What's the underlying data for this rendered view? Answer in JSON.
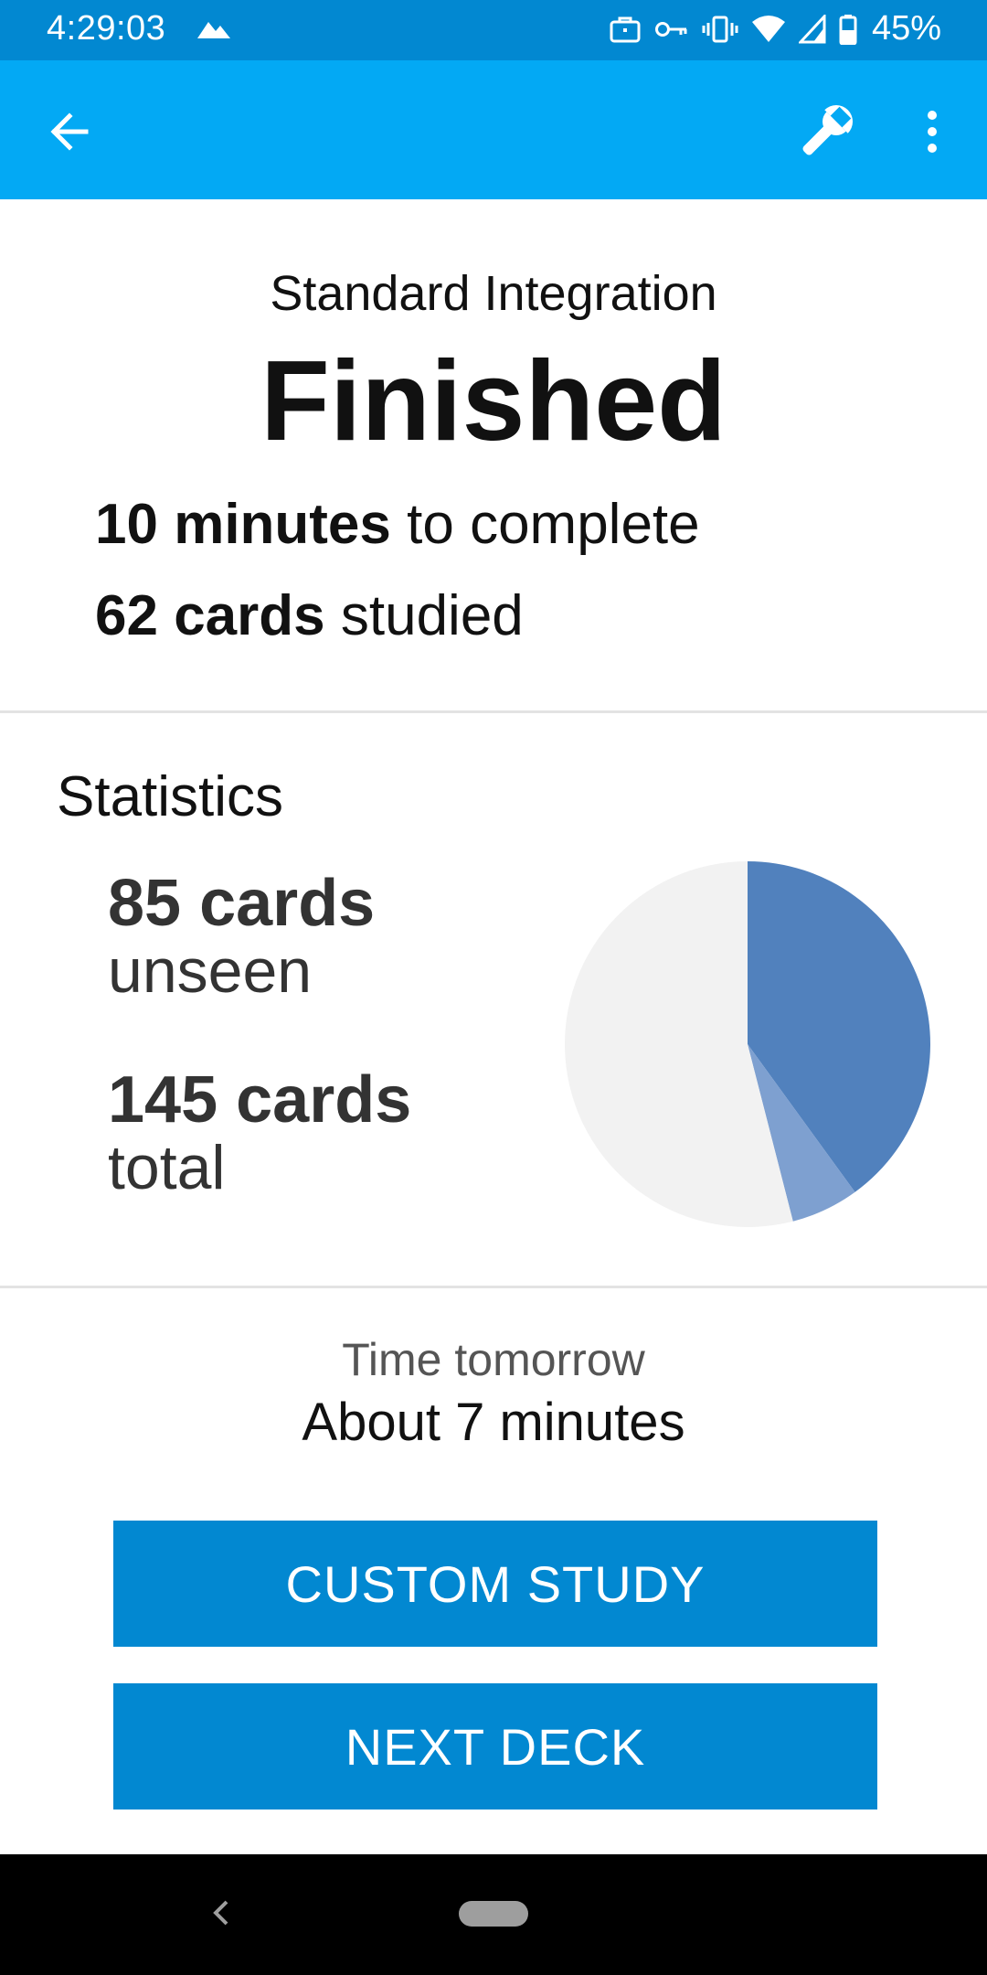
{
  "status_bar": {
    "time": "4:29:03",
    "battery_percent": "45%",
    "icons": [
      "mountain-icon",
      "briefcase-icon",
      "key-icon",
      "vibrate-icon",
      "wifi-icon",
      "cell-signal-icon",
      "battery-icon"
    ]
  },
  "app_bar": {
    "icons": [
      "back-arrow-icon",
      "wrench-icon",
      "more-vert-icon"
    ],
    "background_color": "#03a9f4"
  },
  "summary": {
    "deck_name": "Standard Integration",
    "title": "Finished",
    "time_value": "10 minutes",
    "time_suffix": " to complete",
    "cards_value": "62 cards",
    "cards_suffix": " studied"
  },
  "statistics": {
    "heading": "Statistics",
    "unseen_count": "85 cards",
    "unseen_label": "unseen",
    "total_count": "145 cards",
    "total_label": "total"
  },
  "chart_data": {
    "type": "pie",
    "title": "",
    "slices": [
      {
        "value": 40,
        "color": "#5181bd"
      },
      {
        "value": 6,
        "color": "#7ea0d0"
      },
      {
        "value": 54,
        "color": "#f2f2f2"
      }
    ]
  },
  "tomorrow": {
    "label": "Time tomorrow",
    "value": "About 7 minutes"
  },
  "buttons": {
    "custom_study": "CUSTOM STUDY",
    "next_deck": "NEXT DECK",
    "color": "#0288d1"
  },
  "nav_bar": {
    "icons": [
      "nav-back-icon",
      "home-pill-icon"
    ]
  }
}
